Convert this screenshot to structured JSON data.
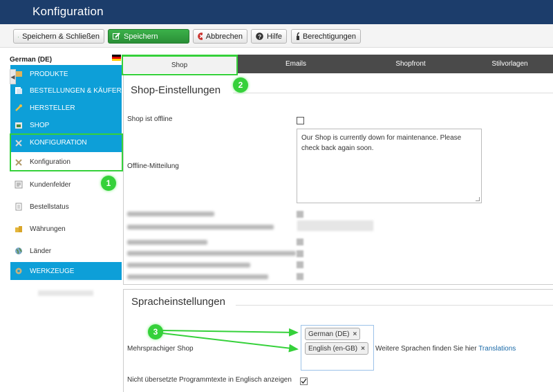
{
  "header": {
    "title": "Konfiguration"
  },
  "toolbar": {
    "save_close": "Speichern & Schließen",
    "save": "Speichern",
    "cancel": "Abbrechen",
    "help": "Hilfe",
    "permissions": "Berechtigungen"
  },
  "sidebar": {
    "language": "German (DE)",
    "items": [
      {
        "label": "PRODUKTE",
        "icon": "products-icon"
      },
      {
        "label": "BESTELLUNGEN & KÄUFER",
        "icon": "orders-icon"
      },
      {
        "label": "HERSTELLER",
        "icon": "wrench-icon"
      },
      {
        "label": "SHOP",
        "icon": "shop-icon"
      },
      {
        "label": "KONFIGURATION",
        "icon": "config-icon"
      },
      {
        "label": "Konfiguration",
        "icon": "tools-icon"
      },
      {
        "label": "Kundenfelder",
        "icon": "user-fields-icon"
      },
      {
        "label": "Bestellstatus",
        "icon": "document-icon"
      },
      {
        "label": "Währungen",
        "icon": "coins-icon"
      },
      {
        "label": "Länder",
        "icon": "globe-icon"
      },
      {
        "label": "WERKZEUGE",
        "icon": "tools-gear-icon"
      }
    ]
  },
  "tabs": [
    {
      "label": "Shop",
      "active": true
    },
    {
      "label": "Emails"
    },
    {
      "label": "Shopfront"
    },
    {
      "label": "Stilvorlagen"
    }
  ],
  "shop_settings": {
    "title": "Shop-Einstellungen",
    "offline_label": "Shop ist offline",
    "offline_checked": false,
    "offline_message_label": "Offline-Mitteilung",
    "offline_message": "Our Shop is currently down for maintenance. Please check back again soon."
  },
  "language_settings": {
    "title": "Spracheinstellungen",
    "multilang_label": "Mehrsprachiger Shop",
    "languages": [
      "German (DE)",
      "English (en-GB)"
    ],
    "more_text": "Weitere Sprachen finden Sie hier",
    "more_link": "Translations",
    "untranslated_label": "Nicht übersetzte Programmtexte in Englisch anzeigen",
    "untranslated_checked": true
  },
  "annotations": [
    "1",
    "2",
    "3"
  ],
  "colors": {
    "accent": "#0d9fd8",
    "highlight": "#35d13a",
    "header": "#1c3d6b",
    "save": "#2a8f37"
  }
}
